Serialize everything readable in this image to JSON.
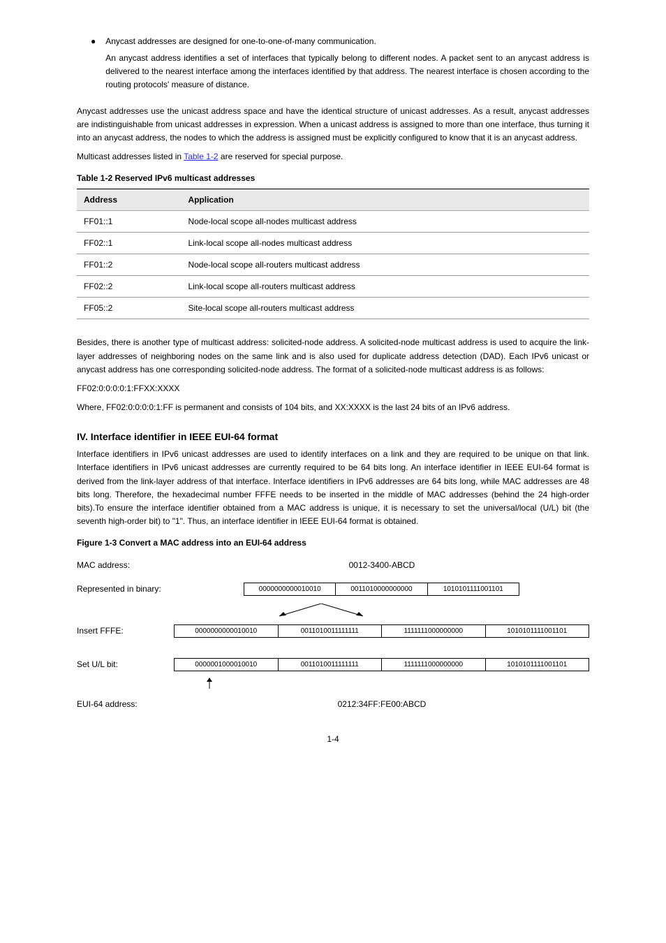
{
  "bullet1": "Anycast addresses are designed for one-to-one-of-many communication.",
  "bullet1_detail": "An anycast address identifies a set of interfaces that typically belong to different nodes. A packet sent to an anycast address is delivered to the nearest interface among the interfaces identified by that address. The nearest interface is chosen according to the routing protocols' measure of distance.",
  "anycast_para": "Anycast addresses use the unicast address space and have the identical structure of unicast addresses. As a result, anycast addresses are indistinguishable from unicast addresses in expression. When a unicast address is assigned to more than one interface, thus turning it into an anycast address, the nodes to which the address is assigned must be explicitly configured to know that it is an anycast address.",
  "multicast_intro": "Multicast addresses listed in ",
  "multicast_link": "Table 1-2",
  "multicast_intro2": " are reserved for special purpose.",
  "table_caption": "Table 1-2 Reserved IPv6 multicast addresses",
  "table": {
    "header1": "Address",
    "header2": "Application",
    "rows": [
      {
        "addr": "FF01::1",
        "app": "Node-local scope all-nodes multicast address"
      },
      {
        "addr": "FF02::1",
        "app": "Link-local scope all-nodes multicast address"
      },
      {
        "addr": "FF01::2",
        "app": "Node-local scope all-routers multicast address"
      },
      {
        "addr": "FF02::2",
        "app": "Link-local scope all-routers multicast address"
      },
      {
        "addr": "FF05::2",
        "app": "Site-local scope all-routers multicast address"
      }
    ]
  },
  "solicited_para": "Besides, there is another type of multicast address: solicited-node address. A solicited-node multicast address is used to acquire the link-layer addresses of neighboring nodes on the same link and is also used for duplicate address detection (DAD). Each IPv6 unicast or anycast address has one corresponding solicited-node address. The format of a solicited-node multicast address is as follows:",
  "solicited_fmt": "FF02:0:0:0:0:1:FFXX:XXXX",
  "solicited_note": "Where, FF02:0:0:0:0:1:FF is permanent and consists of 104 bits, and XX:XXXX is the last 24 bits of an IPv6 address.",
  "heading1": "IV. Interface identifier in IEEE EUI-64 format",
  "eui_intro": "Interface identifiers in IPv6 unicast addresses are used to identify interfaces on a link and they are required to be unique on that link. Interface identifiers in IPv6 unicast addresses are currently required to be 64 bits long. An interface identifier in IEEE EUI-64 format is derived from the link-layer address of that interface. Interface identifiers in IPv6 addresses are 64 bits long, while MAC addresses are 48 bits long. Therefore, the hexadecimal number FFFE needs to be inserted in the middle of MAC addresses (behind the 24 high-order bits).To ensure the interface identifier obtained from a MAC address is unique, it is necessary to set the universal/local (U/L) bit (the seventh high-order bit) to \"1\". Thus, an interface identifier in IEEE EUI-64 format is obtained.",
  "fig_caption": "Figure 1-3 Convert a MAC address into an EUI-64 address",
  "chart_data": {
    "type": "table",
    "rows": [
      {
        "label": "MAC address:",
        "value": "0012-3400-ABCD"
      },
      {
        "label": "Represented in binary:",
        "cells": [
          "0000000000010010",
          "0011010000000000",
          "1010101111001101"
        ]
      },
      {
        "label": "Insert FFFE:",
        "cells": [
          "0000000000010010",
          "0011010011111111",
          "1111111000000000",
          "1010101111001101"
        ]
      },
      {
        "label": "Set U/L bit:",
        "cells": [
          "0000001000010010",
          "0011010011111111",
          "1111111000000000",
          "1010101111001101"
        ]
      },
      {
        "label": "EUI-64 address:",
        "value": "0212:34FF:FE00:ABCD"
      }
    ]
  },
  "page_number": "1-4"
}
